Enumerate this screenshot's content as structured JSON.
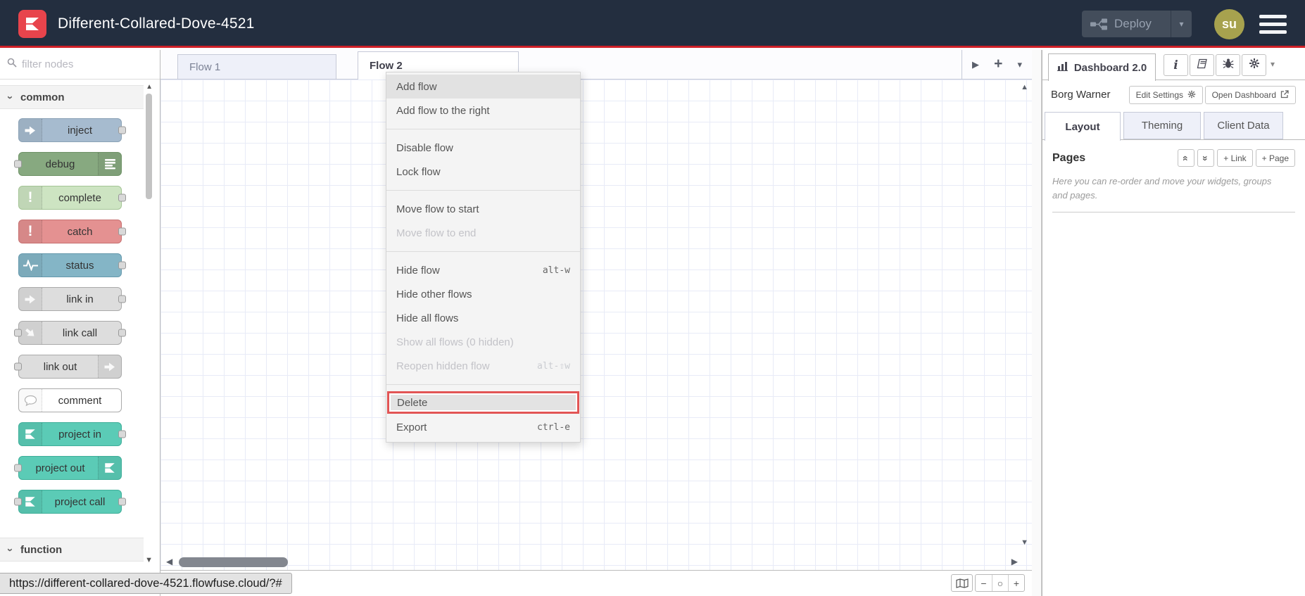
{
  "colors": {
    "header_bg": "#232e3f",
    "accent_red": "#cf2027",
    "logo_red": "#e8444c",
    "avatar_bg": "#a7a24e",
    "delete_highlight_border": "#e25555"
  },
  "header": {
    "title": "Different-Collared-Dove-4521",
    "deploy_label": "Deploy",
    "avatar_text": "su"
  },
  "palette": {
    "filter_placeholder": "filter nodes",
    "sections": [
      {
        "label": "common"
      },
      {
        "label": "function"
      }
    ],
    "nodes": [
      {
        "label": "inject",
        "color": "#a6bbcf",
        "border": "#8ba2b6",
        "icon": "arrow-in-icon",
        "icon_side": "left",
        "ports": "right"
      },
      {
        "label": "debug",
        "color": "#87a980",
        "border": "#6f9367",
        "icon": "list-lines-icon",
        "icon_side": "right",
        "ports": "left"
      },
      {
        "label": "complete",
        "color": "#cde4c2",
        "border": "#a4c495",
        "icon": "exclamation-icon",
        "icon_side": "left",
        "ports": "right"
      },
      {
        "label": "catch",
        "color": "#e49191",
        "border": "#c67070",
        "icon": "exclamation-icon",
        "icon_side": "left",
        "ports": "right"
      },
      {
        "label": "status",
        "color": "#84b5c6",
        "border": "#6699ad",
        "icon": "heartbeat-icon",
        "icon_side": "left",
        "ports": "right"
      },
      {
        "label": "link in",
        "color": "#dddddd",
        "border": "#aaaaaa",
        "icon": "link-arrow-icon",
        "icon_side": "left",
        "ports": "right"
      },
      {
        "label": "link call",
        "color": "#dddddd",
        "border": "#aaaaaa",
        "icon": "link-arrow-icon",
        "icon_side": "left",
        "ports": "both"
      },
      {
        "label": "link out",
        "color": "#dddddd",
        "border": "#aaaaaa",
        "icon": "link-arrow-icon",
        "icon_side": "right",
        "ports": "left"
      },
      {
        "label": "comment",
        "color": "#ffffff",
        "border": "#aaaaaa",
        "icon": "speech-bubble-icon",
        "icon_side": "left",
        "ports": "none"
      },
      {
        "label": "project in",
        "color": "#5bcbb6",
        "border": "#3fae99",
        "icon": "flowfuse-icon",
        "icon_side": "left",
        "ports": "right"
      },
      {
        "label": "project out",
        "color": "#5bcbb6",
        "border": "#3fae99",
        "icon": "flowfuse-icon",
        "icon_side": "right",
        "ports": "left"
      },
      {
        "label": "project call",
        "color": "#5bcbb6",
        "border": "#3fae99",
        "icon": "flowfuse-icon",
        "icon_side": "left",
        "ports": "both"
      }
    ]
  },
  "workspace": {
    "tabs": [
      {
        "label": "Flow 1",
        "active": false
      },
      {
        "label": "Flow 2",
        "active": true
      }
    ]
  },
  "context_menu": {
    "items": [
      {
        "label": "Add flow",
        "highlighted": true
      },
      {
        "label": "Add flow to the right"
      },
      {
        "label": "Disable flow"
      },
      {
        "label": "Lock flow"
      },
      {
        "label": "Move flow to start"
      },
      {
        "label": "Move flow to end",
        "disabled": true
      },
      {
        "label": "Hide flow",
        "shortcut": "alt-w"
      },
      {
        "label": "Hide other flows"
      },
      {
        "label": "Hide all flows"
      },
      {
        "label": "Show all flows (0 hidden)",
        "disabled": true
      },
      {
        "label": "Reopen hidden flow",
        "shortcut": "alt-⇧w",
        "disabled": true
      },
      {
        "label": "Delete",
        "danger": true
      },
      {
        "label": "Export",
        "shortcut": "ctrl-e"
      }
    ]
  },
  "sidebar": {
    "tab_label": "Dashboard 2.0",
    "instance_name": "Borg Warner",
    "edit_settings_label": "Edit Settings",
    "open_dashboard_label": "Open Dashboard",
    "tabs": [
      {
        "label": "Layout",
        "active": true
      },
      {
        "label": "Theming",
        "active": false
      },
      {
        "label": "Client Data",
        "active": false
      }
    ],
    "pages_title": "Pages",
    "link_button": "+ Link",
    "page_button": "+ Page",
    "pages_description": "Here you can re-order and move your widgets, groups and pages."
  },
  "status_bar": {
    "url": "https://different-collared-dove-4521.flowfuse.cloud/?#"
  },
  "glyphs": {
    "exclamation": "!",
    "info": "i",
    "play": "▶",
    "plus": "+",
    "caret_down": "▾",
    "chevron": "›",
    "scroll_left": "◀",
    "scroll_right": "▶",
    "scroll_up": "▲",
    "scroll_down": "▼",
    "minus": "−",
    "reset_zoom": "○",
    "zoom_in": "+",
    "collapse_up": "«",
    "collapse_down": "»"
  }
}
